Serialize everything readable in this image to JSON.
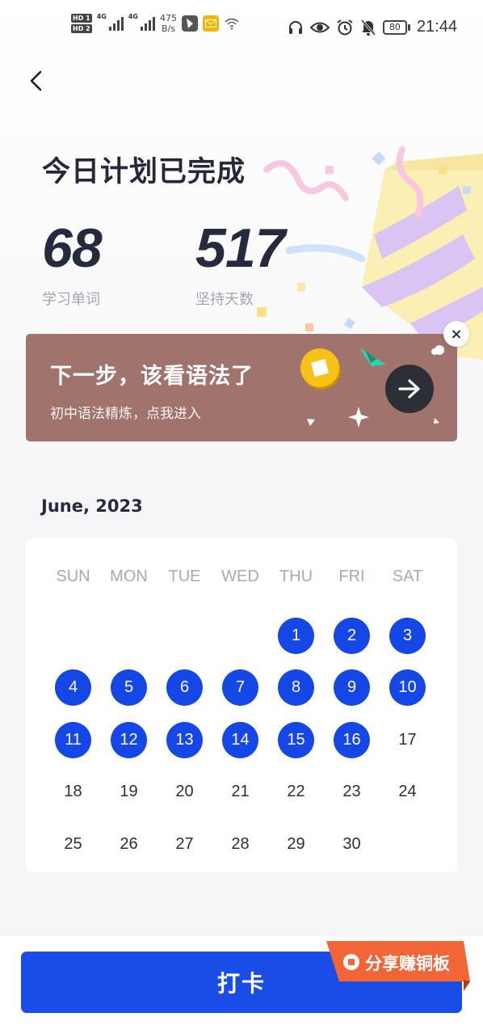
{
  "status_bar": {
    "hd1": "HD 1",
    "hd2": "HD 2",
    "net1": "4G",
    "net2": "4G",
    "speed_value": "475",
    "speed_unit": "B/s",
    "battery": "80",
    "time": "21:44"
  },
  "header": {
    "title": "今日计划已完成"
  },
  "stats": [
    {
      "value": "68",
      "label": "学习单词"
    },
    {
      "value": "517",
      "label": "坚持天数"
    }
  ],
  "banner": {
    "title": "下一步，该看语法了",
    "subtitle": "初中语法精炼，点我进入",
    "close": "×",
    "background": "#a0736c"
  },
  "calendar": {
    "month": "June, 2023",
    "weekdays": [
      "SUN",
      "MON",
      "TUE",
      "WED",
      "THU",
      "FRI",
      "SAT"
    ],
    "first_weekday_index": 4,
    "days_in_month": 30,
    "completed_days": [
      1,
      2,
      3,
      4,
      5,
      6,
      7,
      8,
      9,
      10,
      11,
      12,
      13,
      14,
      15,
      16
    ],
    "completed_color": "#1547e6"
  },
  "footer": {
    "checkin_label": "打卡",
    "share_label": "分享赚铜板",
    "accent": "#1a4de7",
    "share_color": "#f26537"
  },
  "icons": {
    "back": "chevron-left-icon",
    "arrow": "arrow-right-icon",
    "headphones": "headphones-icon",
    "eye": "eye-icon",
    "alarm": "alarm-icon",
    "mute": "bell-off-icon"
  }
}
